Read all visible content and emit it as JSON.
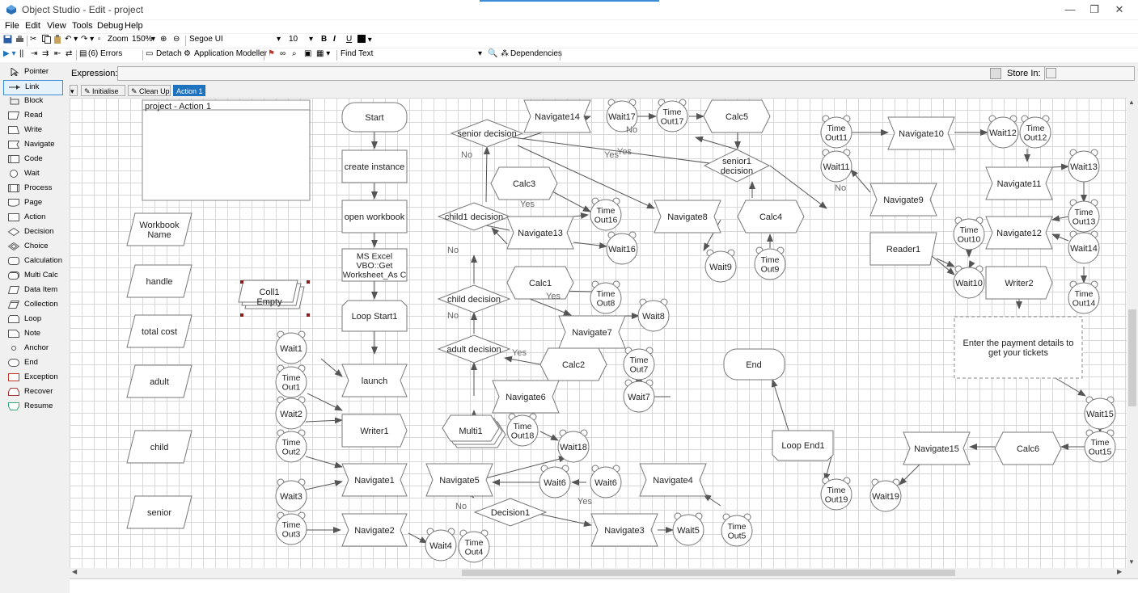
{
  "window": {
    "title": "Object Studio  - Edit - project",
    "min": "—",
    "max": "❐",
    "close": "✕"
  },
  "menu": [
    "File",
    "Edit",
    "View",
    "Tools",
    "Debug",
    "Help"
  ],
  "toolbar1": {
    "zoom_label": "Zoom",
    "zoom_value": "150%",
    "font": "Segoe UI",
    "font_size": "10",
    "bold": "B",
    "italic": "I",
    "underline": "U"
  },
  "toolbar2": {
    "errors": "(6) Errors",
    "detach": "Detach",
    "app_modeller": "Application Modeller",
    "find_text": "Find Text",
    "dependencies": "Dependencies"
  },
  "expression": {
    "label": "Expression:",
    "store_in": "Store In:"
  },
  "palette": [
    "Pointer",
    "Link",
    "Block",
    "Read",
    "Write",
    "Navigate",
    "Code",
    "Wait",
    "Process",
    "Page",
    "Action",
    "Decision",
    "Choice",
    "Calculation",
    "Multi Calc",
    "Data Item",
    "Collection",
    "Loop",
    "Note",
    "Anchor",
    "End",
    "Exception",
    "Recover",
    "Resume"
  ],
  "tabs": [
    {
      "label": "Initialise"
    },
    {
      "label": "Clean Up"
    },
    {
      "label": "Action 1"
    }
  ],
  "diagram": {
    "block_title": "project - Action 1",
    "data_items": [
      "Workbook\nName",
      "handle",
      "total cost",
      "adult",
      "child",
      "senior"
    ],
    "collection": "Coll1\nEmpty",
    "start": "Start",
    "end": "End",
    "actions": [
      "create instance",
      "open workbook",
      "MS Excel\nVBO::Get\nWorksheet_As C"
    ],
    "loop_start": "Loop Start1",
    "loop_end": "Loop End1",
    "navigates": [
      "launch",
      "Navigate1",
      "Navigate2",
      "Navigate3",
      "Navigate4",
      "Navigate5",
      "Navigate6",
      "Navigate7",
      "Navigate8",
      "Navigate9",
      "Navigate10",
      "Navigate11",
      "Navigate12",
      "Navigate13",
      "Navigate14",
      "Navigate15"
    ],
    "writers": [
      "Writer1",
      "Writer2"
    ],
    "reader": "Reader1",
    "calcs": [
      "Calc1",
      "Calc2",
      "Calc3",
      "Calc4",
      "Calc5",
      "Calc6"
    ],
    "multi": "Multi1",
    "decisions": [
      "senior decision",
      "child1 decision",
      "child decision",
      "adult decision",
      "Decision1",
      "senior1\ndecision"
    ],
    "waits": [
      "Wait1",
      "Wait2",
      "Wait3",
      "Wait4",
      "Wait5",
      "Wait6",
      "Wait7",
      "Wait8",
      "Wait9",
      "Wait10",
      "Wait11",
      "Wait12",
      "Wait13",
      "Wait14",
      "Wait15",
      "Wait16",
      "Wait17",
      "Wait18",
      "Wait19"
    ],
    "timeouts": [
      "Time\nOut1",
      "Time\nOut2",
      "Time\nOut3",
      "Time\nOut4",
      "Time\nOut5",
      "Time\nOut6",
      "Time\nOut7",
      "Time\nOut8",
      "Time\nOut9",
      "Time\nOut10",
      "Time\nOut11",
      "Time\nOut12",
      "Time\nOut13",
      "Time\nOut14",
      "Time\nOut15",
      "Time\nOut16",
      "Time\nOut17",
      "Time\nOut18",
      "Time\nOut19"
    ],
    "note": "Enter the payment details to\nget your tickets",
    "yes": "Yes",
    "no": "No"
  }
}
